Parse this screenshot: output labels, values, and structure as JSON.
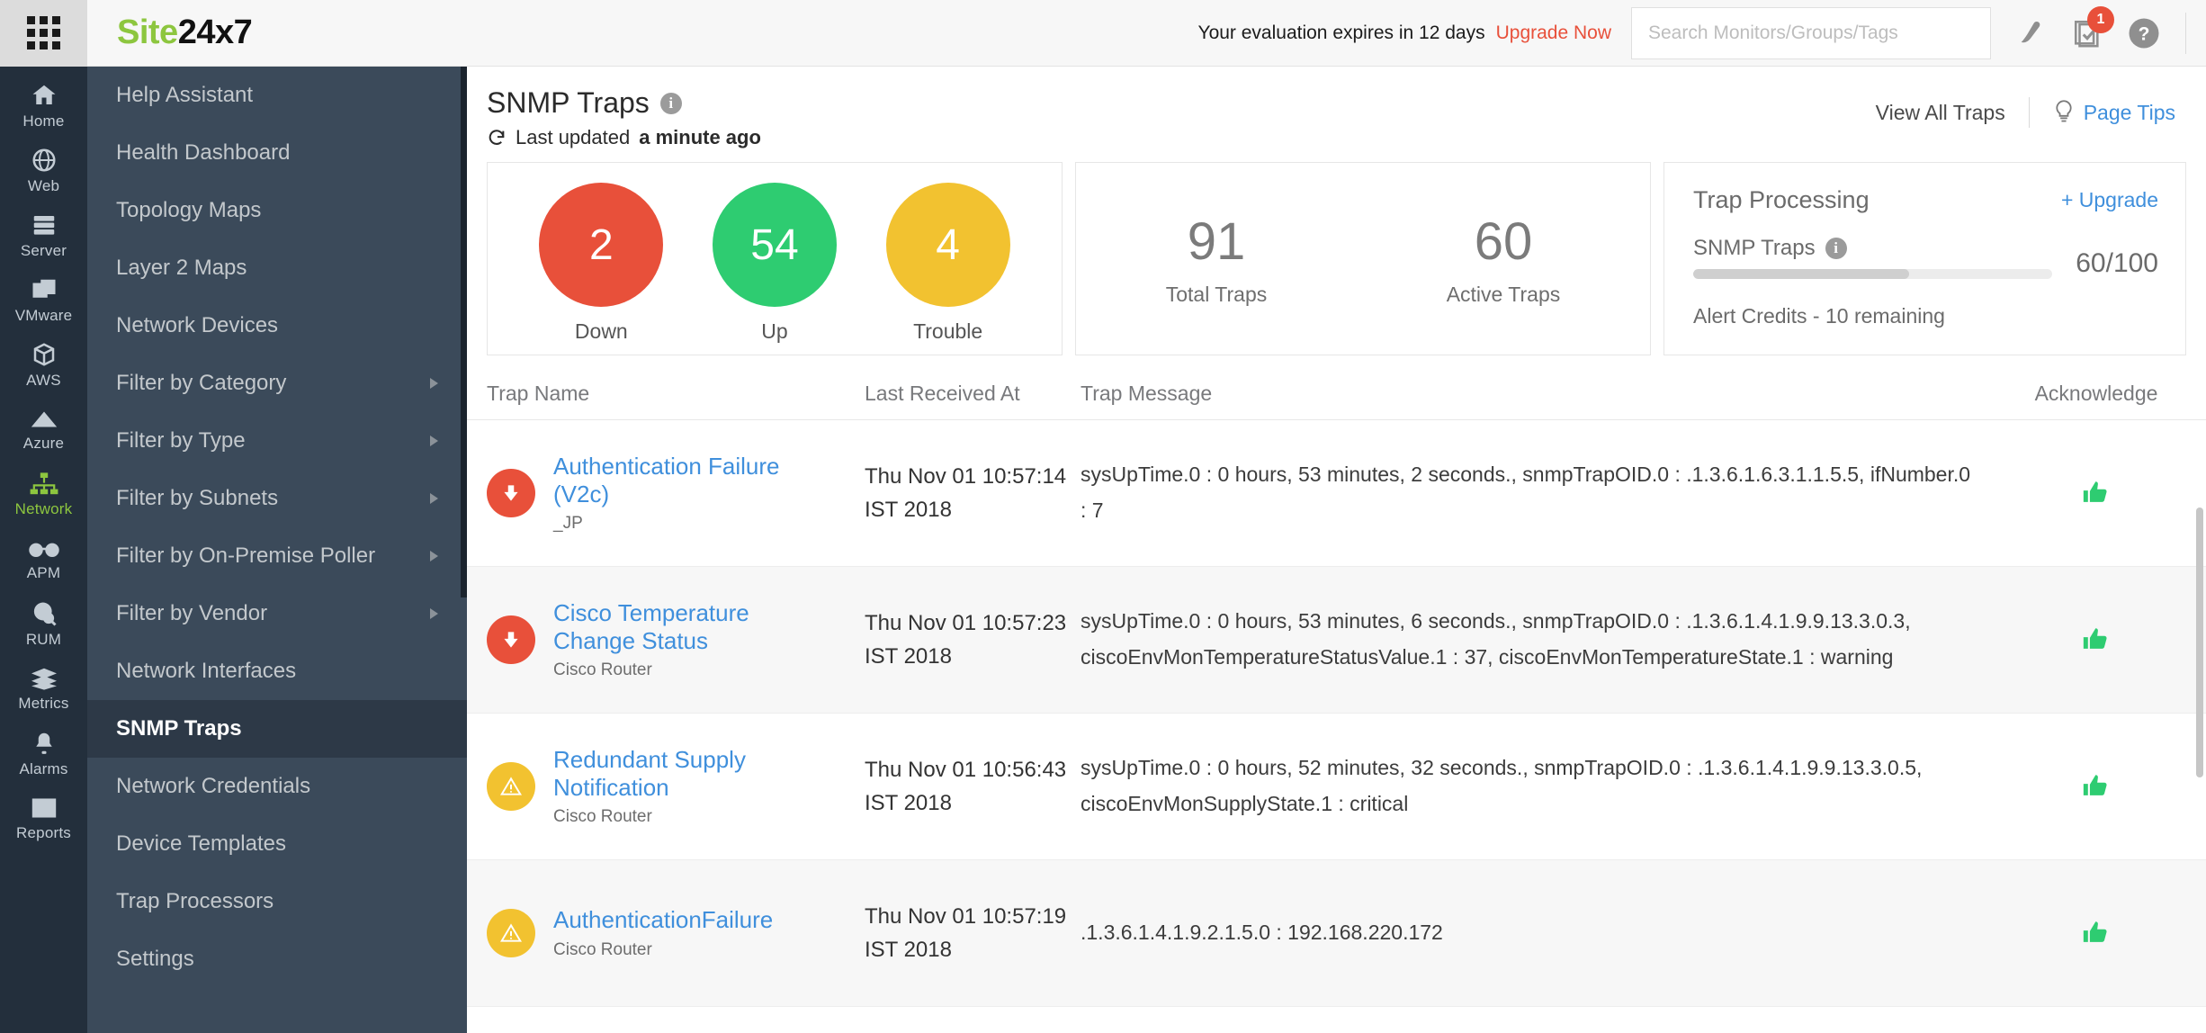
{
  "topbar": {
    "brand_green": "Site",
    "brand_dark": "24x7",
    "eval_notice": "Your evaluation expires in 12 days",
    "upgrade_now": "Upgrade Now",
    "search_placeholder": "Search Monitors/Groups/Tags",
    "search_value": "",
    "notification_count": "1",
    "icons": [
      "pen-icon",
      "notes-icon",
      "help-icon"
    ]
  },
  "rail": {
    "items": [
      {
        "label": "Home",
        "icon": "home-icon",
        "active": false
      },
      {
        "label": "Web",
        "icon": "globe-icon",
        "active": false
      },
      {
        "label": "Server",
        "icon": "server-icon",
        "active": false
      },
      {
        "label": "VMware",
        "icon": "vmware-icon",
        "active": false
      },
      {
        "label": "AWS",
        "icon": "aws-icon",
        "active": false
      },
      {
        "label": "Azure",
        "icon": "azure-icon",
        "active": false
      },
      {
        "label": "Network",
        "icon": "network-icon",
        "active": true
      },
      {
        "label": "APM",
        "icon": "binoculars-icon",
        "active": false
      },
      {
        "label": "RUM",
        "icon": "rum-icon",
        "active": false
      },
      {
        "label": "Metrics",
        "icon": "metrics-icon",
        "active": false
      },
      {
        "label": "Alarms",
        "icon": "bell-icon",
        "active": false
      },
      {
        "label": "Reports",
        "icon": "reports-icon",
        "active": false
      }
    ]
  },
  "menu": {
    "items": [
      {
        "label": "Help Assistant",
        "submenu": false,
        "active": false
      },
      {
        "label": "Health Dashboard",
        "submenu": false,
        "active": false
      },
      {
        "label": "Topology Maps",
        "submenu": false,
        "active": false
      },
      {
        "label": "Layer 2 Maps",
        "submenu": false,
        "active": false
      },
      {
        "label": "Network Devices",
        "submenu": false,
        "active": false
      },
      {
        "label": "Filter by Category",
        "submenu": true,
        "active": false
      },
      {
        "label": "Filter by Type",
        "submenu": true,
        "active": false
      },
      {
        "label": "Filter by Subnets",
        "submenu": true,
        "active": false
      },
      {
        "label": "Filter by On-Premise Poller",
        "submenu": true,
        "active": false
      },
      {
        "label": "Filter by Vendor",
        "submenu": true,
        "active": false
      },
      {
        "label": "Network Interfaces",
        "submenu": false,
        "active": false
      },
      {
        "label": "SNMP Traps",
        "submenu": false,
        "active": true
      },
      {
        "label": "Network Credentials",
        "submenu": false,
        "active": false
      },
      {
        "label": "Device Templates",
        "submenu": false,
        "active": false
      },
      {
        "label": "Trap Processors",
        "submenu": false,
        "active": false
      },
      {
        "label": "Settings",
        "submenu": false,
        "active": false
      }
    ]
  },
  "page": {
    "title": "SNMP Traps",
    "info_icon": "i",
    "last_updated_prefix": "Last updated",
    "last_updated_value": "a minute ago",
    "view_all_traps": "View All Traps",
    "page_tips": "Page Tips"
  },
  "status_card": {
    "bubbles": [
      {
        "value": "2",
        "label": "Down",
        "color": "#e8503a"
      },
      {
        "value": "54",
        "label": "Up",
        "color": "#2ecc71"
      },
      {
        "value": "4",
        "label": "Trouble",
        "color": "#f2c230"
      }
    ]
  },
  "counts_card": {
    "items": [
      {
        "value": "91",
        "label": "Total Traps"
      },
      {
        "value": "60",
        "label": "Active Traps"
      }
    ]
  },
  "processing_card": {
    "title": "Trap Processing",
    "upgrade_label": "+ Upgrade",
    "metric_label": "SNMP Traps",
    "metric_ratio": "60/100",
    "progress_percent": 60,
    "credits_text": "Alert Credits - 10 remaining"
  },
  "table": {
    "headers": {
      "name": "Trap Name",
      "time": "Last Received At",
      "message": "Trap Message",
      "ack": "Acknowledge"
    },
    "rows": [
      {
        "severity": "down",
        "name": "Authentication Failure (V2c)",
        "device": "_JP",
        "time": "Thu Nov 01 10:57:14 IST 2018",
        "message": "sysUpTime.0 : 0 hours, 53 minutes, 2 seconds., snmpTrapOID.0 : .1.3.6.1.6.3.1.1.5.5, ifNumber.0 : 7",
        "ack_icon": "thumbs-up-icon"
      },
      {
        "severity": "down",
        "name": "Cisco Temperature Change Status",
        "device": "Cisco Router",
        "time": "Thu Nov 01 10:57:23 IST 2018",
        "message": "sysUpTime.0 : 0 hours, 53 minutes, 6 seconds., snmpTrapOID.0 : .1.3.6.1.4.1.9.9.13.3.0.3, ciscoEnvMonTemperatureStatusValue.1 : 37, ciscoEnvMonTemperatureState.1 : warning",
        "ack_icon": "thumbs-up-icon"
      },
      {
        "severity": "trouble",
        "name": "Redundant Supply Notification",
        "device": "Cisco Router",
        "time": "Thu Nov 01 10:56:43 IST 2018",
        "message": "sysUpTime.0 : 0 hours, 52 minutes, 32 seconds., snmpTrapOID.0 : .1.3.6.1.4.1.9.9.13.3.0.5, ciscoEnvMonSupplyState.1 : critical",
        "ack_icon": "thumbs-up-icon"
      },
      {
        "severity": "trouble",
        "name": "AuthenticationFailure",
        "device": "Cisco Router",
        "time": "Thu Nov 01 10:57:19 IST 2018",
        "message": ".1.3.6.1.4.1.9.2.1.5.0 : 192.168.220.172",
        "ack_icon": "thumbs-up-icon"
      }
    ]
  }
}
